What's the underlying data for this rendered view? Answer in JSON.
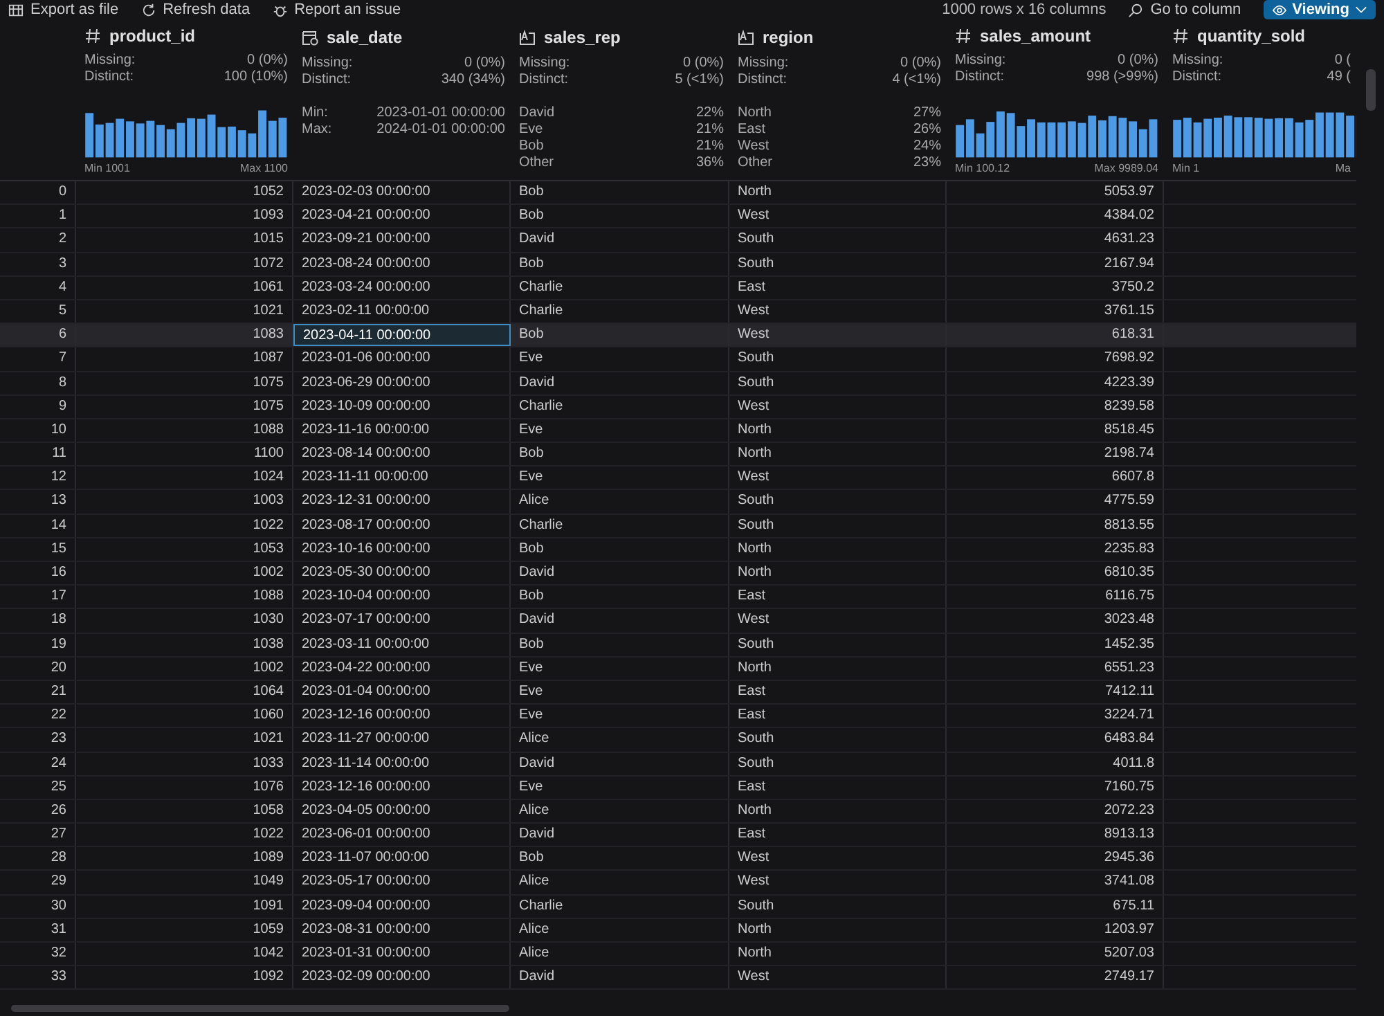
{
  "toolbar": {
    "actions": [
      {
        "kind": "export",
        "label": "Export as file"
      },
      {
        "kind": "refresh",
        "label": "Refresh data"
      },
      {
        "kind": "issue",
        "label": "Report an issue"
      }
    ],
    "shape": "1000 rows x 16 columns",
    "goto": "Go to column",
    "mode": "Viewing"
  },
  "columns": [
    {
      "name": "product_id",
      "kind": "number",
      "missing_label": "Missing:",
      "missing": "0 (0%)",
      "distinct_label": "Distinct:",
      "distinct": "100 (10%)",
      "min": "Min 1001",
      "max": "Max 1100"
    },
    {
      "name": "sale_date",
      "kind": "date",
      "missing_label": "Missing:",
      "missing": "0 (0%)",
      "distinct_label": "Distinct:",
      "distinct": "340 (34%)",
      "min_label": "Min:",
      "min": "2023-01-01 00:00:00",
      "max_label": "Max:",
      "max": "2024-01-01 00:00:00"
    },
    {
      "name": "sales_rep",
      "kind": "text",
      "missing_label": "Missing:",
      "missing": "0 (0%)",
      "distinct_label": "Distinct:",
      "distinct": "5 (<1%)",
      "top": [
        {
          "label": "David",
          "share": "22%"
        },
        {
          "label": "Eve",
          "share": "21%"
        },
        {
          "label": "Bob",
          "share": "21%"
        },
        {
          "label": "Other",
          "share": "36%"
        }
      ]
    },
    {
      "name": "region",
      "kind": "text",
      "missing_label": "Missing:",
      "missing": "0 (0%)",
      "distinct_label": "Distinct:",
      "distinct": "4 (<1%)",
      "top": [
        {
          "label": "North",
          "share": "27%"
        },
        {
          "label": "East",
          "share": "26%"
        },
        {
          "label": "West",
          "share": "24%"
        },
        {
          "label": "Other",
          "share": "23%"
        }
      ]
    },
    {
      "name": "sales_amount",
      "kind": "number",
      "missing_label": "Missing:",
      "missing": "0 (0%)",
      "distinct_label": "Distinct:",
      "distinct": "998 (>99%)",
      "min": "Min 100.12",
      "max": "Max 9989.04"
    },
    {
      "name": "quantity_sold",
      "kind": "number",
      "missing_label": "Missing:",
      "missing": "0 (",
      "distinct_label": "Distinct:",
      "distinct": "49 (",
      "min": "Min 1",
      "max": "Ma"
    }
  ],
  "rows": [
    {
      "cells": [
        "0",
        "1052",
        "2023-02-03 00:00:00",
        "Bob",
        "North",
        "5053.97"
      ],
      "selected": false,
      "focused": [
        false,
        false,
        false,
        false,
        false,
        false
      ]
    },
    {
      "cells": [
        "1",
        "1093",
        "2023-04-21 00:00:00",
        "Bob",
        "West",
        "4384.02"
      ],
      "selected": false,
      "focused": [
        false,
        false,
        false,
        false,
        false,
        false
      ]
    },
    {
      "cells": [
        "2",
        "1015",
        "2023-09-21 00:00:00",
        "David",
        "South",
        "4631.23"
      ],
      "selected": false,
      "focused": [
        false,
        false,
        false,
        false,
        false,
        false
      ]
    },
    {
      "cells": [
        "3",
        "1072",
        "2023-08-24 00:00:00",
        "Bob",
        "South",
        "2167.94"
      ],
      "selected": false,
      "focused": [
        false,
        false,
        false,
        false,
        false,
        false
      ]
    },
    {
      "cells": [
        "4",
        "1061",
        "2023-03-24 00:00:00",
        "Charlie",
        "East",
        "3750.2"
      ],
      "selected": false,
      "focused": [
        false,
        false,
        false,
        false,
        false,
        false
      ]
    },
    {
      "cells": [
        "5",
        "1021",
        "2023-02-11 00:00:00",
        "Charlie",
        "West",
        "3761.15"
      ],
      "selected": false,
      "focused": [
        false,
        false,
        false,
        false,
        false,
        false
      ]
    },
    {
      "cells": [
        "6",
        "1083",
        "2023-04-11 00:00:00",
        "Bob",
        "West",
        "618.31"
      ],
      "selected": true,
      "focused": [
        false,
        false,
        true,
        false,
        false,
        false
      ]
    },
    {
      "cells": [
        "7",
        "1087",
        "2023-01-06 00:00:00",
        "Eve",
        "South",
        "7698.92"
      ],
      "selected": false,
      "focused": [
        false,
        false,
        false,
        false,
        false,
        false
      ]
    },
    {
      "cells": [
        "8",
        "1075",
        "2023-06-29 00:00:00",
        "David",
        "South",
        "4223.39"
      ],
      "selected": false,
      "focused": [
        false,
        false,
        false,
        false,
        false,
        false
      ]
    },
    {
      "cells": [
        "9",
        "1075",
        "2023-10-09 00:00:00",
        "Charlie",
        "West",
        "8239.58"
      ],
      "selected": false,
      "focused": [
        false,
        false,
        false,
        false,
        false,
        false
      ]
    },
    {
      "cells": [
        "10",
        "1088",
        "2023-11-16 00:00:00",
        "Eve",
        "North",
        "8518.45"
      ],
      "selected": false,
      "focused": [
        false,
        false,
        false,
        false,
        false,
        false
      ]
    },
    {
      "cells": [
        "11",
        "1100",
        "2023-08-14 00:00:00",
        "Bob",
        "North",
        "2198.74"
      ],
      "selected": false,
      "focused": [
        false,
        false,
        false,
        false,
        false,
        false
      ]
    },
    {
      "cells": [
        "12",
        "1024",
        "2023-11-11 00:00:00",
        "Eve",
        "West",
        "6607.8"
      ],
      "selected": false,
      "focused": [
        false,
        false,
        false,
        false,
        false,
        false
      ]
    },
    {
      "cells": [
        "13",
        "1003",
        "2023-12-31 00:00:00",
        "Alice",
        "South",
        "4775.59"
      ],
      "selected": false,
      "focused": [
        false,
        false,
        false,
        false,
        false,
        false
      ]
    },
    {
      "cells": [
        "14",
        "1022",
        "2023-08-17 00:00:00",
        "Charlie",
        "South",
        "8813.55"
      ],
      "selected": false,
      "focused": [
        false,
        false,
        false,
        false,
        false,
        false
      ]
    },
    {
      "cells": [
        "15",
        "1053",
        "2023-10-16 00:00:00",
        "Bob",
        "North",
        "2235.83"
      ],
      "selected": false,
      "focused": [
        false,
        false,
        false,
        false,
        false,
        false
      ]
    },
    {
      "cells": [
        "16",
        "1002",
        "2023-05-30 00:00:00",
        "David",
        "North",
        "6810.35"
      ],
      "selected": false,
      "focused": [
        false,
        false,
        false,
        false,
        false,
        false
      ]
    },
    {
      "cells": [
        "17",
        "1088",
        "2023-10-04 00:00:00",
        "Bob",
        "East",
        "6116.75"
      ],
      "selected": false,
      "focused": [
        false,
        false,
        false,
        false,
        false,
        false
      ]
    },
    {
      "cells": [
        "18",
        "1030",
        "2023-07-17 00:00:00",
        "David",
        "West",
        "3023.48"
      ],
      "selected": false,
      "focused": [
        false,
        false,
        false,
        false,
        false,
        false
      ]
    },
    {
      "cells": [
        "19",
        "1038",
        "2023-03-11 00:00:00",
        "Bob",
        "South",
        "1452.35"
      ],
      "selected": false,
      "focused": [
        false,
        false,
        false,
        false,
        false,
        false
      ]
    },
    {
      "cells": [
        "20",
        "1002",
        "2023-04-22 00:00:00",
        "Eve",
        "North",
        "6551.23"
      ],
      "selected": false,
      "focused": [
        false,
        false,
        false,
        false,
        false,
        false
      ]
    },
    {
      "cells": [
        "21",
        "1064",
        "2023-01-04 00:00:00",
        "Eve",
        "East",
        "7412.11"
      ],
      "selected": false,
      "focused": [
        false,
        false,
        false,
        false,
        false,
        false
      ]
    },
    {
      "cells": [
        "22",
        "1060",
        "2023-12-16 00:00:00",
        "Eve",
        "East",
        "3224.71"
      ],
      "selected": false,
      "focused": [
        false,
        false,
        false,
        false,
        false,
        false
      ]
    },
    {
      "cells": [
        "23",
        "1021",
        "2023-11-27 00:00:00",
        "Alice",
        "South",
        "6483.84"
      ],
      "selected": false,
      "focused": [
        false,
        false,
        false,
        false,
        false,
        false
      ]
    },
    {
      "cells": [
        "24",
        "1033",
        "2023-11-14 00:00:00",
        "David",
        "South",
        "4011.8"
      ],
      "selected": false,
      "focused": [
        false,
        false,
        false,
        false,
        false,
        false
      ]
    },
    {
      "cells": [
        "25",
        "1076",
        "2023-12-16 00:00:00",
        "Eve",
        "East",
        "7160.75"
      ],
      "selected": false,
      "focused": [
        false,
        false,
        false,
        false,
        false,
        false
      ]
    },
    {
      "cells": [
        "26",
        "1058",
        "2023-04-05 00:00:00",
        "Alice",
        "North",
        "2072.23"
      ],
      "selected": false,
      "focused": [
        false,
        false,
        false,
        false,
        false,
        false
      ]
    },
    {
      "cells": [
        "27",
        "1022",
        "2023-06-01 00:00:00",
        "David",
        "East",
        "8913.13"
      ],
      "selected": false,
      "focused": [
        false,
        false,
        false,
        false,
        false,
        false
      ]
    },
    {
      "cells": [
        "28",
        "1089",
        "2023-11-07 00:00:00",
        "Bob",
        "West",
        "2945.36"
      ],
      "selected": false,
      "focused": [
        false,
        false,
        false,
        false,
        false,
        false
      ]
    },
    {
      "cells": [
        "29",
        "1049",
        "2023-05-17 00:00:00",
        "Alice",
        "West",
        "3741.08"
      ],
      "selected": false,
      "focused": [
        false,
        false,
        false,
        false,
        false,
        false
      ]
    },
    {
      "cells": [
        "30",
        "1091",
        "2023-09-04 00:00:00",
        "Charlie",
        "South",
        "675.11"
      ],
      "selected": false,
      "focused": [
        false,
        false,
        false,
        false,
        false,
        false
      ]
    },
    {
      "cells": [
        "31",
        "1059",
        "2023-08-31 00:00:00",
        "Alice",
        "North",
        "1203.97"
      ],
      "selected": false,
      "focused": [
        false,
        false,
        false,
        false,
        false,
        false
      ]
    },
    {
      "cells": [
        "32",
        "1042",
        "2023-01-31 00:00:00",
        "Alice",
        "North",
        "5207.03"
      ],
      "selected": false,
      "focused": [
        false,
        false,
        false,
        false,
        false,
        false
      ]
    },
    {
      "cells": [
        "33",
        "1092",
        "2023-02-09 00:00:00",
        "David",
        "West",
        "2749.17"
      ],
      "selected": false,
      "focused": [
        false,
        false,
        false,
        false,
        false,
        false
      ]
    }
  ]
}
